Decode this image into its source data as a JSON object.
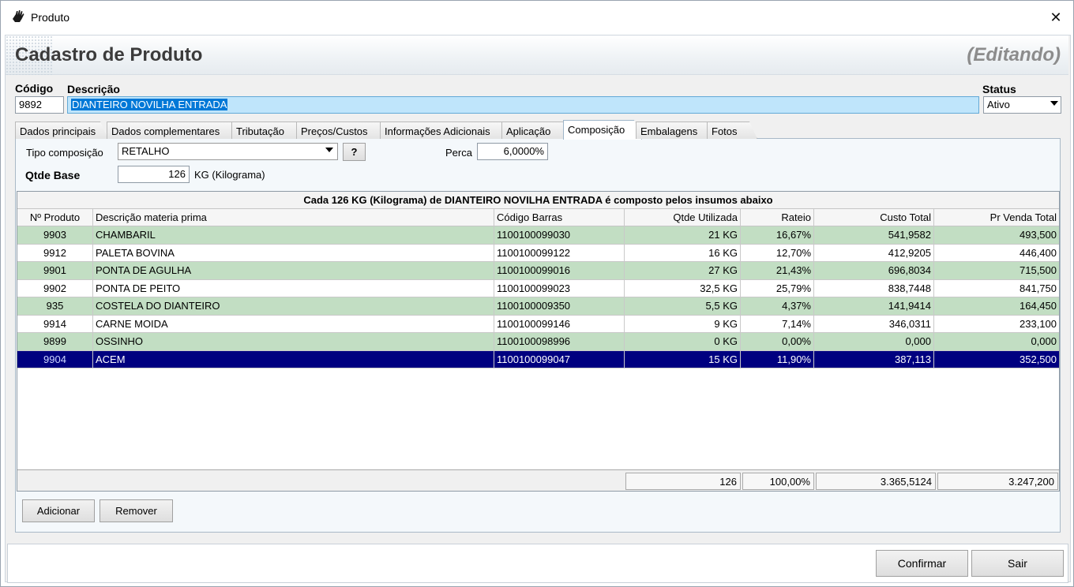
{
  "window": {
    "title": "Produto",
    "close": "✕"
  },
  "header": {
    "title": "Cadastro de Produto",
    "mode": "(Editando)"
  },
  "form": {
    "codigo_label": "Código",
    "codigo_value": "9892",
    "descricao_label": "Descrição",
    "descricao_value": "DIANTEIRO NOVILHA ENTRADA",
    "status_label": "Status",
    "status_value": "Ativo"
  },
  "tabs": [
    {
      "label": "Dados principais"
    },
    {
      "label": "Dados complementares"
    },
    {
      "label": "Tributação"
    },
    {
      "label": "Preços/Custos"
    },
    {
      "label": "Informações Adicionais"
    },
    {
      "label": "Aplicação"
    },
    {
      "label": "Composição"
    },
    {
      "label": "Embalagens"
    },
    {
      "label": "Fotos"
    }
  ],
  "composicao": {
    "tipo_label": "Tipo composição",
    "tipo_value": "RETALHO",
    "help_label": "?",
    "perca_label": "Perca",
    "perca_value": "6,0000%",
    "qtde_label": "Qtde Base",
    "qtde_value": "126",
    "qtde_unit": "KG (Kilograma)"
  },
  "grid": {
    "caption": "Cada 126 KG (Kilograma) de  DIANTEIRO NOVILHA ENTRADA é composto pelos insumos abaixo",
    "columns": [
      "Nº Produto",
      "Descrição materia prima",
      "Código Barras",
      "Qtde Utilizada",
      "Rateio",
      "Custo Total",
      "Pr Venda Total"
    ],
    "rows": [
      [
        "9903",
        "CHAMBARIL",
        "1100100099030",
        "21 KG",
        "16,67%",
        "541,9582",
        "493,500"
      ],
      [
        "9912",
        "PALETA BOVINA",
        "1100100099122",
        "16 KG",
        "12,70%",
        "412,9205",
        "446,400"
      ],
      [
        "9901",
        "PONTA DE AGULHA",
        "1100100099016",
        "27 KG",
        "21,43%",
        "696,8034",
        "715,500"
      ],
      [
        "9902",
        "PONTA DE PEITO",
        "1100100099023",
        "32,5 KG",
        "25,79%",
        "838,7448",
        "841,750"
      ],
      [
        "935",
        "COSTELA DO DIANTEIRO",
        "1100100009350",
        "5,5 KG",
        "4,37%",
        "141,9414",
        "164,450"
      ],
      [
        "9914",
        "CARNE MOIDA",
        "1100100099146",
        "9 KG",
        "7,14%",
        "346,0311",
        "233,100"
      ],
      [
        "9899",
        "OSSINHO",
        "1100100098996",
        "0 KG",
        "0,00%",
        "0,000",
        "0,000"
      ],
      [
        "9904",
        "ACEM",
        "1100100099047",
        "15 KG",
        "11,90%",
        "387,113",
        "352,500"
      ]
    ],
    "totals": {
      "qtde": "126",
      "rateio": "100,00%",
      "custo": "3.365,5124",
      "venda": "3.247,200"
    }
  },
  "buttons": {
    "add": "Adicionar",
    "remove": "Remover",
    "confirm": "Confirmar",
    "exit": "Sair"
  }
}
